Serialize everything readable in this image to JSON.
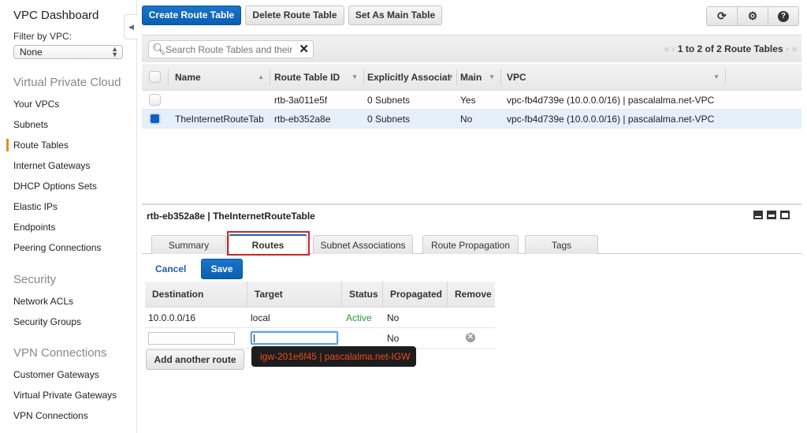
{
  "sidebar": {
    "title": "VPC Dashboard",
    "filter_label": "Filter by VPC:",
    "filter_value": "None",
    "sections": [
      {
        "title": "Virtual Private Cloud",
        "items": [
          "Your VPCs",
          "Subnets",
          "Route Tables",
          "Internet Gateways",
          "DHCP Options Sets",
          "Elastic IPs",
          "Endpoints",
          "Peering Connections"
        ]
      },
      {
        "title": "Security",
        "items": [
          "Network ACLs",
          "Security Groups"
        ]
      },
      {
        "title": "VPN Connections",
        "items": [
          "Customer Gateways",
          "Virtual Private Gateways",
          "VPN Connections"
        ]
      }
    ],
    "active_item": "Route Tables",
    "accent_color": "#e58b24"
  },
  "toolbar": {
    "create_label": "Create Route Table",
    "delete_label": "Delete Route Table",
    "set_main_label": "Set As Main Table",
    "icons": [
      "refresh-icon",
      "gear-icon",
      "help-icon"
    ]
  },
  "filter": {
    "search_placeholder": "Search Route Tables and their properties",
    "pager_text": "1 to 2 of 2 Route Tables"
  },
  "grid": {
    "columns": [
      "Name",
      "Route Table ID",
      "Explicitly Associat",
      "Main",
      "VPC"
    ],
    "rows": [
      {
        "name": "",
        "id": "rtb-3a011e5f",
        "assoc": "0 Subnets",
        "main": "Yes",
        "vpc": "vpc-fb4d739e (10.0.0.0/16) | pascalalma.net-VPC",
        "selected": false
      },
      {
        "name": "TheInternetRouteTable",
        "id": "rtb-eb352a8e",
        "assoc": "0 Subnets",
        "main": "No",
        "vpc": "vpc-fb4d739e (10.0.0.0/16) | pascalalma.net-VPC",
        "selected": true
      }
    ]
  },
  "detail": {
    "title": "rtb-eb352a8e | TheInternetRouteTable",
    "tabs": [
      "Summary",
      "Routes",
      "Subnet Associations",
      "Route Propagation",
      "Tags"
    ],
    "active_tab": "Routes",
    "cancel_label": "Cancel",
    "save_label": "Save",
    "routes": {
      "columns": [
        "Destination",
        "Target",
        "Status",
        "Propagated",
        "Remove"
      ],
      "rows": [
        {
          "destination": "10.0.0.0/16",
          "target": "local",
          "status": "Active",
          "propagated": "No"
        }
      ],
      "new_row": {
        "destination": "",
        "target": "",
        "propagated": "No"
      },
      "add_label": "Add another route",
      "suggestion": "igw-201e6f45 | pascalalma.net-IGW",
      "status_color": "#2a9a3a"
    }
  }
}
